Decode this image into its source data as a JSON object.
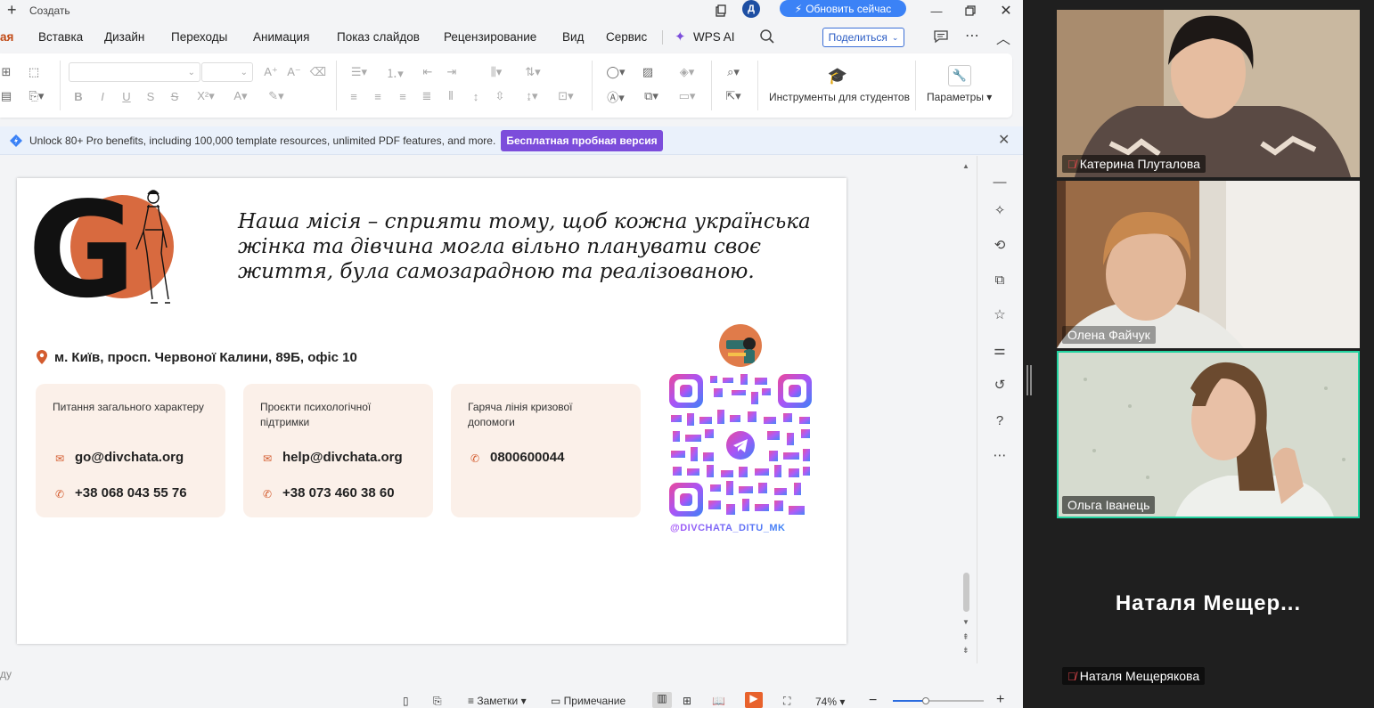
{
  "titlebar": {
    "create_label": "Создать",
    "avatar_letter": "Д",
    "update_label": "Обновить сейчас"
  },
  "menu": {
    "items": [
      "ая",
      "Вставка",
      "Дизайн",
      "Переходы",
      "Анимация",
      "Показ слайдов",
      "Рецензирование",
      "Вид",
      "Сервис",
      "WPS AI"
    ],
    "share_label": "Поделиться"
  },
  "ribbon": {
    "students_tools": "Инструменты для студентов",
    "params": "Параметры"
  },
  "banner": {
    "message": "Unlock 80+ Pro benefits, including 100,000 template resources, unlimited PDF features, and more.",
    "trial_button": "Бесплатная пробная версия"
  },
  "slide": {
    "mission": "Наша місія – сприяти тому, щоб кожна українська жінка та дівчина могла вільно планувати своє життя, була самозарадною та реалізованою.",
    "address": "м. Київ, просп. Червоної Калини, 89Б, офіс 10",
    "cards": [
      {
        "title": "Питання загального характеру",
        "email": "go@divchata.org",
        "phone": "+38 068 043 55 76"
      },
      {
        "title": "Проєкти психологічної підтримки",
        "email": "help@divchata.org",
        "phone": "+38 073 460 38 60"
      },
      {
        "title": "Гаряча лінія кризової допомоги",
        "phone": "0800600044"
      }
    ],
    "instagram_handle": "@DIVCHATA_DITU_MK",
    "logo_letter": "G"
  },
  "notes_stub": "ду",
  "statusbar": {
    "notes": "Заметки",
    "comment": "Примечание",
    "zoom": "74%"
  },
  "participants": [
    {
      "name": "Катерина Плуталова",
      "muted": true
    },
    {
      "name": "Олена Файчук",
      "muted": false
    },
    {
      "name": "Ольга Іванець",
      "muted": false,
      "speaking": true
    },
    {
      "name": "Наталя Мещерякова",
      "muted": true,
      "display_name": "Наталя  Мещер..."
    }
  ],
  "colors": {
    "accent": "#c14a16",
    "brand_orange": "#d86a3f",
    "wps_blue": "#3b82f6",
    "trial_purple": "#7c4ddb",
    "speaker_border": "#22d3a0"
  }
}
